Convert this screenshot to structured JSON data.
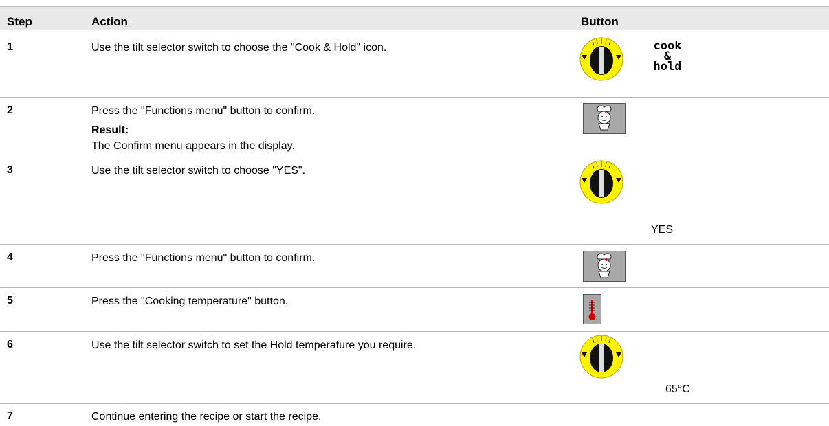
{
  "headers": {
    "step": "Step",
    "action": "Action",
    "button": "Button"
  },
  "rows": [
    {
      "step": "1",
      "action": "Use the tilt selector switch to choose the \"Cook & Hold\" icon.",
      "icon_label": [
        "cook",
        "&",
        "hold"
      ]
    },
    {
      "step": "2",
      "action": "Press the \"Functions menu\" button to confirm.",
      "result_label": "Result:",
      "result_text": "The Confirm menu appears in the display."
    },
    {
      "step": "3",
      "action": "Use the tilt selector switch to choose \"YES\".",
      "value": "YES"
    },
    {
      "step": "4",
      "action": "Press the \"Functions menu\" button to confirm."
    },
    {
      "step": "5",
      "action": "Press the \"Cooking temperature\" button."
    },
    {
      "step": "6",
      "action": "Use the tilt selector switch to set the Hold temperature you require.",
      "value": "65°C"
    },
    {
      "step": "7",
      "action": "Continue entering the recipe or start the recipe."
    }
  ],
  "icons": {
    "knob": "tilt-selector-knob-icon",
    "functions": "chef-functions-menu-icon",
    "temperature": "thermometer-icon"
  },
  "colors": {
    "header_bg": "#e9e9e9",
    "knob_yellow": "#fff200",
    "button_gray": "#a8a8a8",
    "thermometer_red": "#d20000",
    "chef_mark_red": "#e3001b"
  }
}
